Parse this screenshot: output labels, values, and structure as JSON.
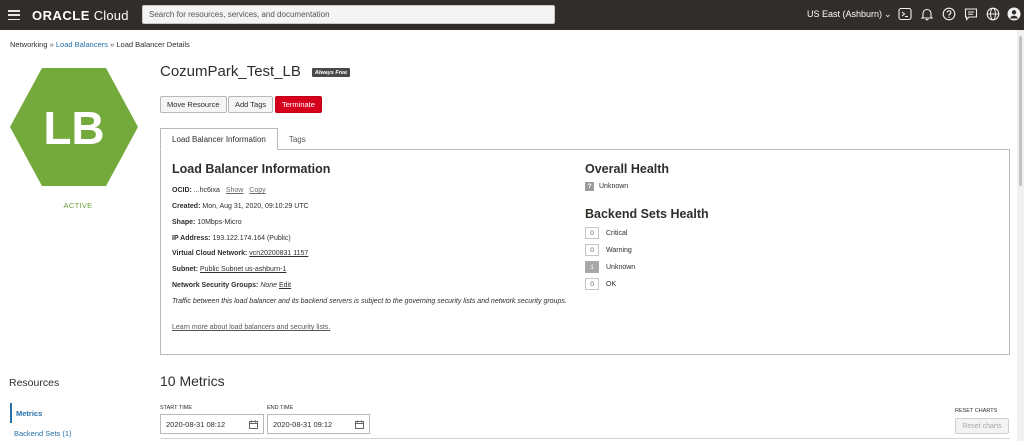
{
  "topbar": {
    "logo_brand": "ORACLE",
    "logo_product": "Cloud",
    "search_placeholder": "Search for resources, services, and documentation",
    "region": "US East (Ashburn)"
  },
  "breadcrumb": {
    "items": [
      "Networking",
      "Load Balancers",
      "Load Balancer Details"
    ],
    "separator": "»"
  },
  "resource": {
    "icon_text": "LB",
    "status": "ACTIVE",
    "name": "CozumPark_Test_LB",
    "badge": "Always Free",
    "icon_color": "#74a93b",
    "status_color": "#6aa23d"
  },
  "actions": {
    "move": "Move Resource",
    "tags": "Add Tags",
    "terminate": "Terminate"
  },
  "tabs": [
    "Load Balancer Information",
    "Tags"
  ],
  "info": {
    "heading": "Load Balancer Information",
    "ocid_label": "OCID:",
    "ocid_value": "...hc6ixa",
    "show": "Show",
    "copy": "Copy",
    "created_label": "Created:",
    "created_value": "Mon, Aug 31, 2020, 09:10:29 UTC",
    "shape_label": "Shape:",
    "shape_value": "10Mbps-Micro",
    "ip_label": "IP Address:",
    "ip_value": "193.122.174.164 (Public)",
    "vcn_label": "Virtual Cloud Network:",
    "vcn_value": "vcn20200831 1157",
    "subnet_label": "Subnet:",
    "subnet_value": "Public Subnet us-ashburn-1",
    "nsg_label": "Network Security Groups:",
    "nsg_value": "None",
    "nsg_edit": "Edit",
    "note": "Traffic between this load balancer and its backend servers is subject to the governing security lists and network security groups.",
    "learn_more": "Learn more about load balancers and security lists."
  },
  "health": {
    "heading": "Overall Health",
    "overall_icon": "?",
    "overall_status": "Unknown",
    "backend_heading": "Backend Sets Health",
    "rows": [
      {
        "count": "0",
        "label": "Critical"
      },
      {
        "count": "0",
        "label": "Warning"
      },
      {
        "count": "1",
        "label": "Unknown"
      },
      {
        "count": "0",
        "label": "OK"
      }
    ]
  },
  "sidebar": {
    "title": "Resources",
    "items": [
      "Metrics",
      "Backend Sets (1)"
    ]
  },
  "metrics": {
    "title": "10 Metrics",
    "start_label": "START TIME",
    "start_value": "2020-08-31 08:12",
    "end_label": "END TIME",
    "end_value": "2020-08-31 09:12",
    "reset_label": "RESET CHARTS",
    "reset_button": "Reset charts"
  },
  "icons": [
    "menu-icon",
    "chevron-down-icon",
    "cloud-shell-icon",
    "bell-icon",
    "help-icon",
    "chat-icon",
    "globe-icon",
    "user-icon",
    "calendar-icon"
  ]
}
